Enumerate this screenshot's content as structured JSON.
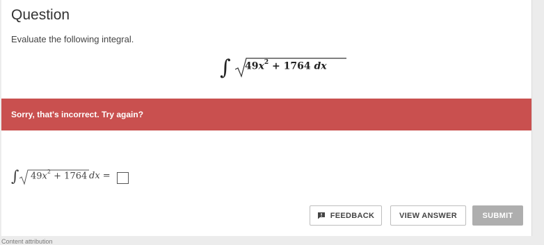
{
  "question": {
    "title": "Question",
    "prompt": "Evaluate the following integral.",
    "integral": {
      "radicand_coefficient": "49",
      "variable": "x",
      "exponent": "2",
      "operator": "+",
      "constant": "1764",
      "differential": "dx"
    }
  },
  "feedback_banner": {
    "message": "Sorry, that's incorrect. Try again?",
    "color": "#c9504f"
  },
  "answer": {
    "radicand_coefficient": "49",
    "variable": "x",
    "exponent": "2",
    "operator": "+",
    "constant": "1764",
    "differential": "dx",
    "equals": "=",
    "input_value": ""
  },
  "buttons": {
    "feedback_label": "FEEDBACK",
    "view_answer_label": "VIEW ANSWER",
    "submit_label": "SUBMIT"
  },
  "footer": {
    "attribution": "Content attribution"
  },
  "icons": {
    "feedback": "feedback-icon"
  }
}
